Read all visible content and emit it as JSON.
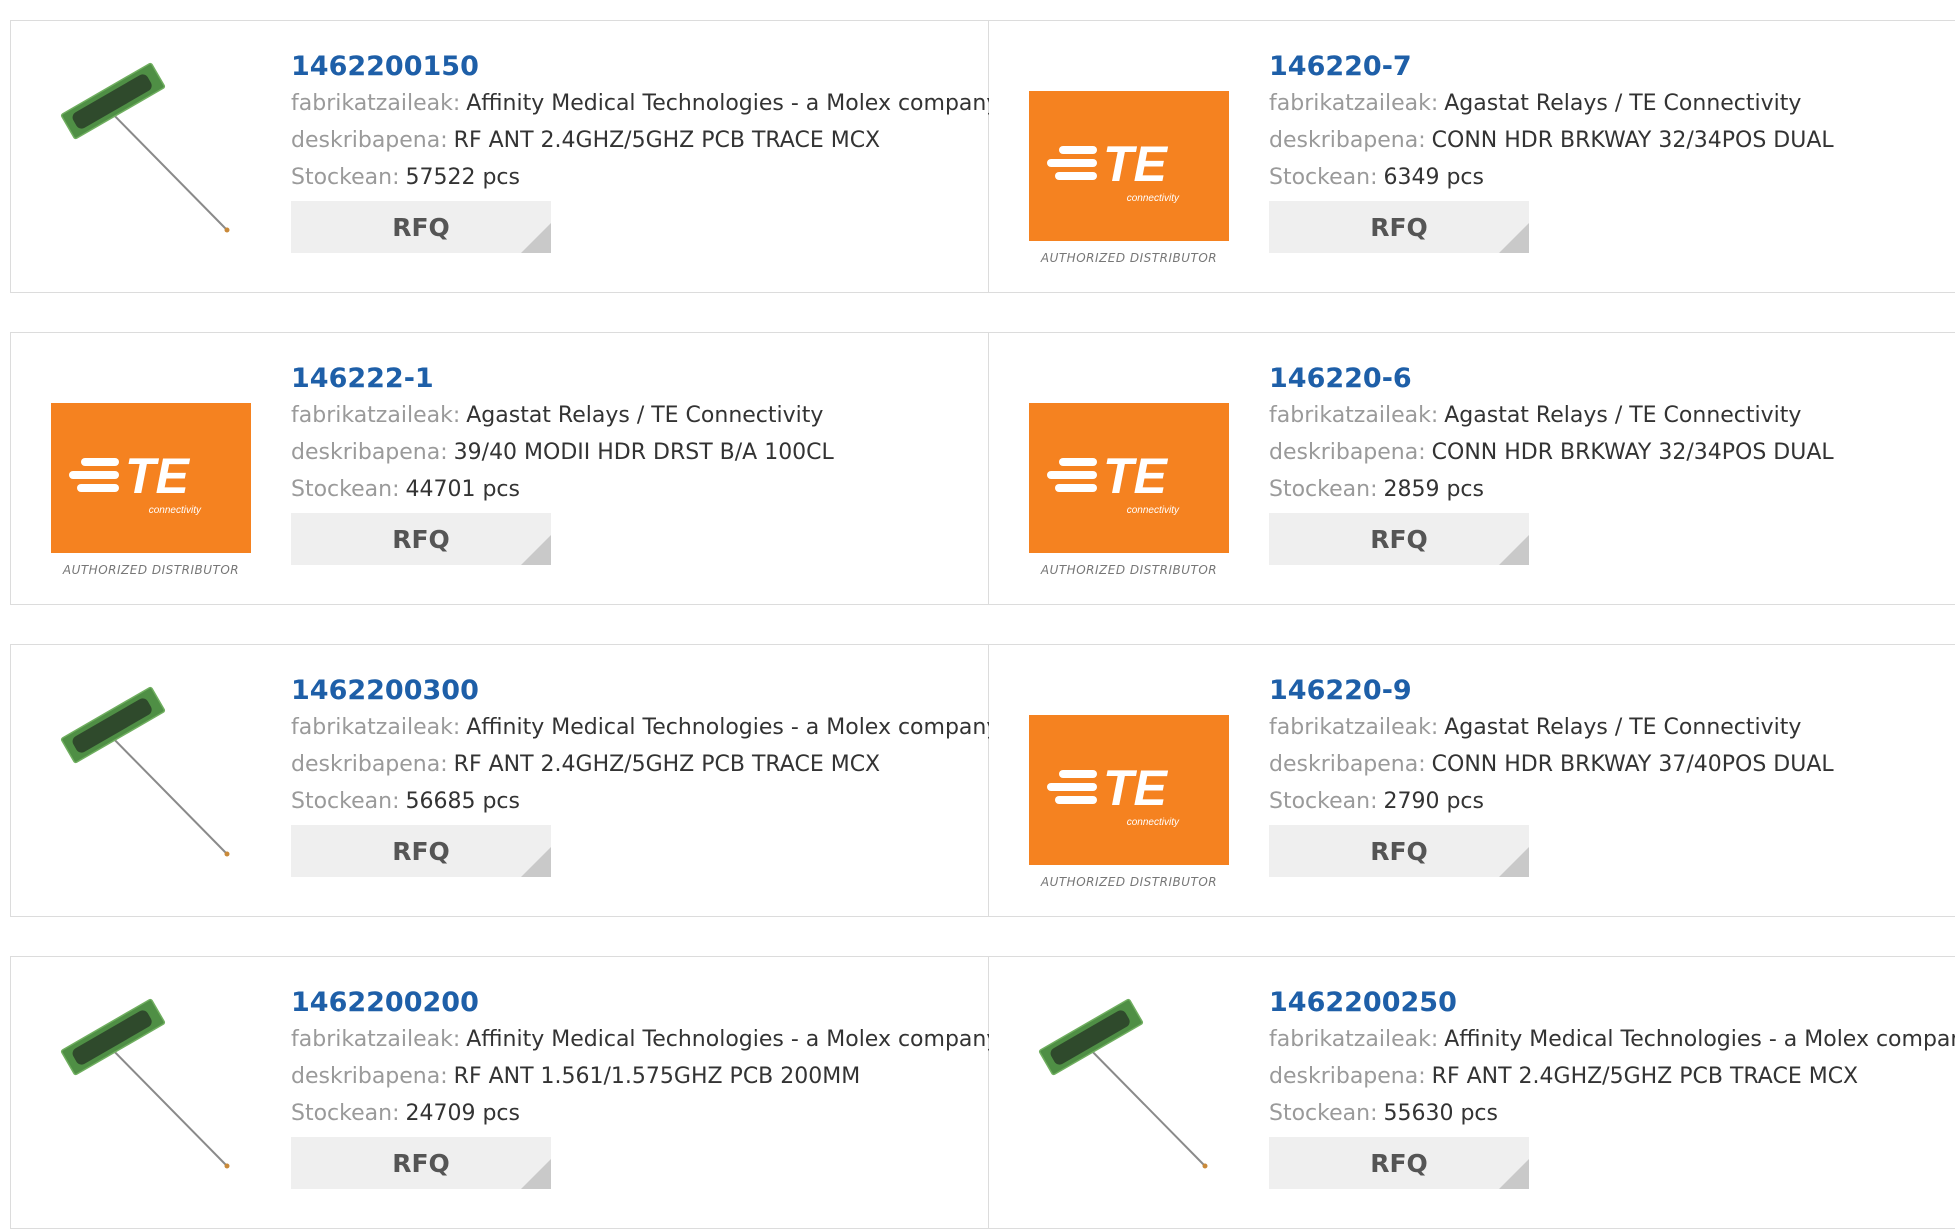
{
  "labels": {
    "manufacturer": "fabrikatzaileak:",
    "description": "deskribapena:",
    "stock": "Stockean:",
    "rfq": "RFQ",
    "authorized": "AUTHORIZED DISTRIBUTOR",
    "te_brand": "TE",
    "te_sub": "connectivity"
  },
  "colors": {
    "title": "#1e5fa8",
    "te_orange": "#f58220",
    "pcb_green": "#3f7a3a"
  },
  "products": [
    {
      "part": "1462200150",
      "manufacturer": "Affinity Medical Technologies - a Molex company",
      "description": "RF ANT 2.4GHZ/5GHZ PCB TRACE MCX",
      "stock": "57522 pcs",
      "image": "antenna-image"
    },
    {
      "part": "146220-7",
      "manufacturer": "Agastat Relays / TE Connectivity",
      "description": "CONN HDR BRKWAY 32/34POS DUAL",
      "stock": "6349 pcs",
      "image": "te-logo"
    },
    {
      "part": "146222-1",
      "manufacturer": "Agastat Relays / TE Connectivity",
      "description": "39/40 MODII HDR DRST B/A 100CL",
      "stock": "44701 pcs",
      "image": "te-logo"
    },
    {
      "part": "146220-6",
      "manufacturer": "Agastat Relays / TE Connectivity",
      "description": "CONN HDR BRKWAY 32/34POS DUAL",
      "stock": "2859 pcs",
      "image": "te-logo"
    },
    {
      "part": "1462200300",
      "manufacturer": "Affinity Medical Technologies - a Molex company",
      "description": "RF ANT 2.4GHZ/5GHZ PCB TRACE MCX",
      "stock": "56685 pcs",
      "image": "antenna-image"
    },
    {
      "part": "146220-9",
      "manufacturer": "Agastat Relays / TE Connectivity",
      "description": "CONN HDR BRKWAY 37/40POS DUAL",
      "stock": "2790 pcs",
      "image": "te-logo"
    },
    {
      "part": "1462200200",
      "manufacturer": "Affinity Medical Technologies - a Molex company",
      "description": "RF ANT 1.561/1.575GHZ PCB 200MM",
      "stock": "24709 pcs",
      "image": "antenna-image"
    },
    {
      "part": "1462200250",
      "manufacturer": "Affinity Medical Technologies - a Molex company",
      "description": "RF ANT 2.4GHZ/5GHZ PCB TRACE MCX",
      "stock": "55630 pcs",
      "image": "antenna-image"
    }
  ]
}
